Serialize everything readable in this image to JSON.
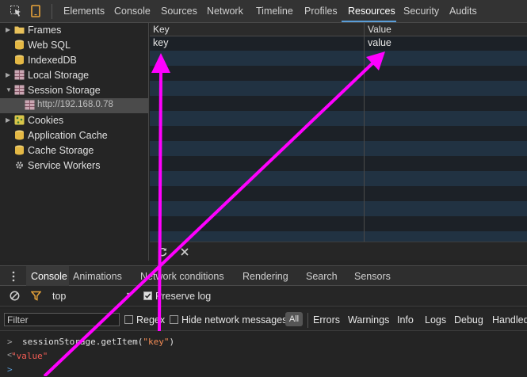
{
  "devtools_tabs": [
    "Elements",
    "Console",
    "Sources",
    "Network",
    "Timeline",
    "Profiles",
    "Resources",
    "Security",
    "Audits"
  ],
  "active_tab": "Resources",
  "sidebar": {
    "items": [
      {
        "label": "Frames",
        "icon": "folder-icon",
        "expandable": true
      },
      {
        "label": "Web SQL",
        "icon": "database-icon",
        "expandable": false
      },
      {
        "label": "IndexedDB",
        "icon": "database-icon",
        "expandable": false
      },
      {
        "label": "Local Storage",
        "icon": "storage-grid-icon",
        "expandable": true
      },
      {
        "label": "Session Storage",
        "icon": "storage-grid-icon",
        "expandable": true,
        "expanded": true
      },
      {
        "label": "http://192.168.0.78",
        "icon": "storage-grid-icon",
        "selected": true
      },
      {
        "label": "Cookies",
        "icon": "cookie-icon",
        "expandable": true
      },
      {
        "label": "Application Cache",
        "icon": "database-icon",
        "expandable": false
      },
      {
        "label": "Cache Storage",
        "icon": "database-icon",
        "expandable": false
      },
      {
        "label": "Service Workers",
        "icon": "gear-icon",
        "expandable": false
      }
    ]
  },
  "storage_table": {
    "columns": [
      "Key",
      "Value"
    ],
    "rows": [
      {
        "key": "key",
        "value": "value"
      }
    ]
  },
  "drawer_tabs": [
    "Console",
    "Animations",
    "Network conditions",
    "Rendering",
    "Search",
    "Sensors"
  ],
  "active_drawer_tab": "Console",
  "console_toolbar": {
    "context": "top",
    "preserve_log_label": "Preserve log",
    "preserve_log_checked": true
  },
  "filter_bar": {
    "placeholder": "Filter",
    "regex_label": "Regex",
    "hide_network_label": "Hide network messages",
    "all_label": "All",
    "levels": [
      "Errors",
      "Warnings",
      "Info",
      "Logs",
      "Debug",
      "Handled"
    ]
  },
  "console": {
    "command_fn": "sessionStorage.getItem(",
    "command_arg": "\"key\"",
    "command_close": ")",
    "result": "\"value\""
  },
  "colors": {
    "accent": "#5a9dd8",
    "annotation": "#ff00ff",
    "row_alt": "#213242",
    "string": "#f28b54"
  }
}
